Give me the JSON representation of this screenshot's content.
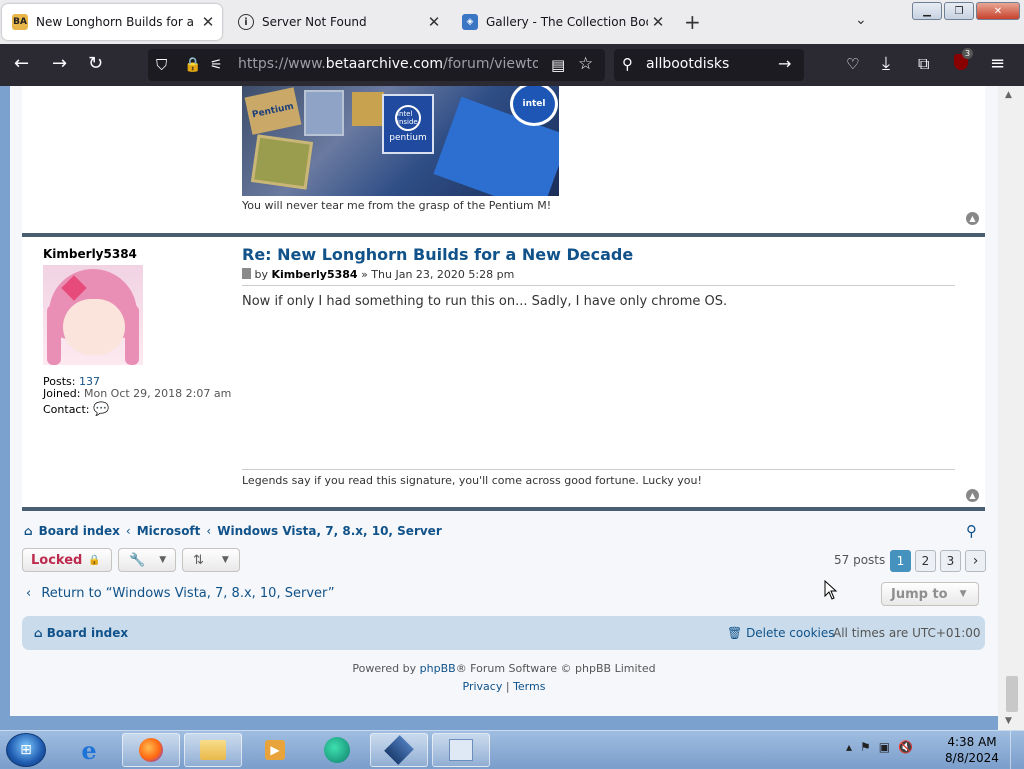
{
  "tabs": [
    {
      "title": "New Longhorn Builds for a New Decade",
      "favicon": "BA",
      "active": true
    },
    {
      "title": "Server Not Found",
      "favicon": "info-icon",
      "active": false
    },
    {
      "title": "Gallery - The Collection Book",
      "favicon": "gallery-icon",
      "active": false
    }
  ],
  "tab_close": "✕",
  "new_tab": "+",
  "url": {
    "prefix": "https://www.",
    "host": "betaarchive.com",
    "path": "/forum/viewtopic.php"
  },
  "search_text": "allbootdisks",
  "extensions_badge": "3",
  "prev_post": {
    "image_label_1": "Pentium",
    "image_label_2": "intel inside",
    "image_label_3": "pentium",
    "signature": "You will never tear me from the grasp of the Pentium M!"
  },
  "post": {
    "author": "Kimberly5384",
    "title": "Re: New Longhorn Builds for a New Decade",
    "by": "by",
    "author_link": "Kimberly5384",
    "date": "» Thu Jan 23, 2020 5:28 pm",
    "content": "Now if only I had something to run this on... Sadly, I have only chrome OS.",
    "posts_label": "Posts:",
    "posts_value": "137",
    "joined_label": "Joined:",
    "joined_value": "Mon Oct 29, 2018 2:07 am",
    "contact_label": "Contact:",
    "signature": "Legends say if you read this signature, you'll come across good fortune. Lucky you!"
  },
  "breadcrumbs": [
    "Board index",
    "Microsoft",
    "Windows Vista, 7, 8.x, 10, Server"
  ],
  "buttons": {
    "locked": "Locked"
  },
  "pagination": {
    "count": "57 posts",
    "pages": [
      "1",
      "2",
      "3"
    ],
    "current": "1"
  },
  "return_link": "Return to “Windows Vista, 7, 8.x, 10, Server”",
  "jump_to": "Jump to",
  "footer": {
    "board_index": "Board index",
    "delete_cookies": "Delete cookies",
    "timezone": "All times are UTC+01:00",
    "powered_prefix": "Powered by",
    "phpbb": "phpBB",
    "powered_suffix": "® Forum Software © phpBB Limited",
    "privacy": "Privacy",
    "sep": "|",
    "terms": "Terms"
  },
  "clock": {
    "time": "4:38 AM",
    "date": "8/8/2024"
  },
  "colors": {
    "link": "#105289",
    "accent": "#4692bf",
    "locked": "#bc2a4d"
  }
}
